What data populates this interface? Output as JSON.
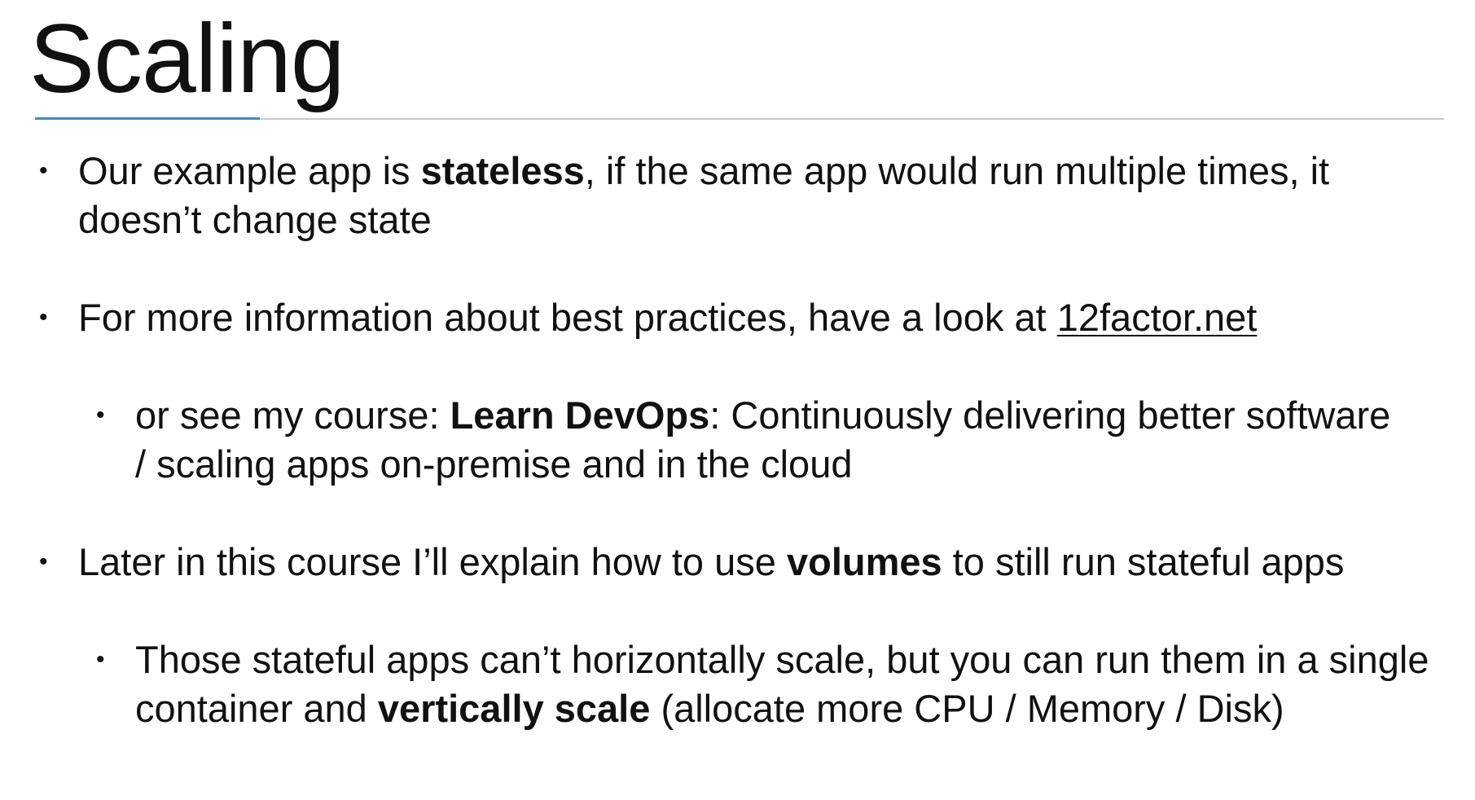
{
  "slide": {
    "title": "Scaling",
    "colors": {
      "accent_rule": "#4a86c0",
      "rule": "#c8c8c8",
      "text": "#111111",
      "background": "#ffffff"
    },
    "bullets": [
      {
        "level": 1,
        "before": "Our example app is ",
        "bold": "stateless",
        "after": ", if the same app would run multiple times, it doesn’t change state"
      },
      {
        "level": 1,
        "before": "For more information about best practices, have a look at ",
        "link": "12factor.net"
      },
      {
        "level": 2,
        "before": "or see my course: ",
        "bold": "Learn DevOps",
        "after": ": Continuously delivering better software / scaling apps on-premise and in the cloud"
      },
      {
        "level": 1,
        "before": "Later in this course I’ll explain how to use ",
        "bold": "volumes",
        "after": " to still run stateful apps"
      },
      {
        "level": 2,
        "before": "Those stateful apps can’t horizontally scale, but you can run them in a single container and ",
        "bold": "vertically scale",
        "after": " (allocate more CPU / Memory / Disk)"
      }
    ],
    "bullet_glyph": "•"
  }
}
